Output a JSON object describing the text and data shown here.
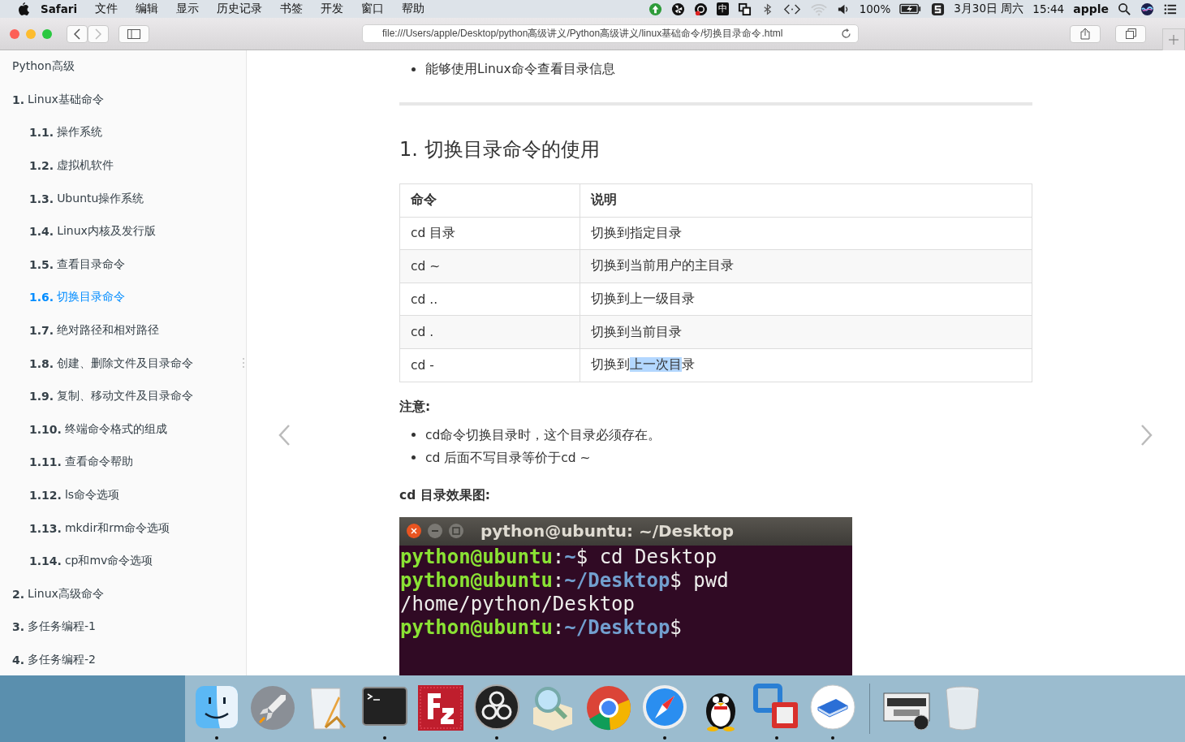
{
  "menu_bar": {
    "app": "Safari",
    "menus": [
      "文件",
      "编辑",
      "显示",
      "历史记录",
      "书签",
      "开发",
      "窗口",
      "帮助"
    ],
    "status": [
      {
        "kind": "update"
      },
      {
        "kind": "fan"
      },
      {
        "kind": "recorder"
      },
      {
        "kind": "input",
        "text": "中"
      },
      {
        "kind": "windows"
      },
      {
        "kind": "bluetooth"
      },
      {
        "kind": "code"
      },
      {
        "kind": "wifi"
      },
      {
        "kind": "volume"
      },
      {
        "kind": "text",
        "text": "100%"
      },
      {
        "kind": "battery"
      },
      {
        "kind": "sogou"
      },
      {
        "kind": "text",
        "text": "3月30日 周六"
      },
      {
        "kind": "text",
        "text": "15:44"
      },
      {
        "kind": "bold",
        "text": "apple"
      },
      {
        "kind": "search"
      },
      {
        "kind": "siri"
      },
      {
        "kind": "list"
      }
    ]
  },
  "toolbar": {
    "address": "file:///Users/apple/Desktop/python高级讲义/Python高级讲义/linux基础命令/切换目录命令.html"
  },
  "sidebar": {
    "title": "Python高级",
    "chapters": [
      {
        "number": "1.",
        "label": "Linux基础命令",
        "selected": false,
        "children": [
          {
            "number": "1.1.",
            "label": "操作系统",
            "selected": false
          },
          {
            "number": "1.2.",
            "label": "虚拟机软件",
            "selected": false
          },
          {
            "number": "1.3.",
            "label": "Ubuntu操作系统",
            "selected": false
          },
          {
            "number": "1.4.",
            "label": "Linux内核及发行版",
            "selected": false
          },
          {
            "number": "1.5.",
            "label": "查看目录命令",
            "selected": false
          },
          {
            "number": "1.6.",
            "label": "切换目录命令",
            "selected": true
          },
          {
            "number": "1.7.",
            "label": "绝对路径和相对路径",
            "selected": false
          },
          {
            "number": "1.8.",
            "label": "创建、删除文件及目录命令",
            "selected": false
          },
          {
            "number": "1.9.",
            "label": "复制、移动文件及目录命令",
            "selected": false
          },
          {
            "number": "1.10.",
            "label": "终端命令格式的组成",
            "selected": false
          },
          {
            "number": "1.11.",
            "label": "查看命令帮助",
            "selected": false
          },
          {
            "number": "1.12.",
            "label": "ls命令选项",
            "selected": false
          },
          {
            "number": "1.13.",
            "label": "mkdir和rm命令选项",
            "selected": false
          },
          {
            "number": "1.14.",
            "label": "cp和mv命令选项",
            "selected": false
          }
        ]
      },
      {
        "number": "2.",
        "label": "Linux高级命令",
        "selected": false
      },
      {
        "number": "3.",
        "label": "多任务编程-1",
        "selected": false
      },
      {
        "number": "4.",
        "label": "多任务编程-2",
        "selected": false
      }
    ]
  },
  "article": {
    "intro_bullets": [
      "能够使用Linux命令查看目录信息"
    ],
    "heading": "1. 切换目录命令的使用",
    "table": {
      "columns": [
        "命令",
        "说明"
      ],
      "rows": [
        [
          [
            {
              "text": "cd 目录",
              "selected": false
            }
          ],
          [
            {
              "text": "切换到指定目录",
              "selected": false
            }
          ]
        ],
        [
          [
            {
              "text": "cd ~",
              "selected": false
            }
          ],
          [
            {
              "text": "切换到当前用户的主目录",
              "selected": false
            }
          ]
        ],
        [
          [
            {
              "text": "cd ..",
              "selected": false
            }
          ],
          [
            {
              "text": "切换到上一级目录",
              "selected": false
            }
          ]
        ],
        [
          [
            {
              "text": "cd .",
              "selected": false
            }
          ],
          [
            {
              "text": "切换到当前目录",
              "selected": false
            }
          ]
        ],
        [
          [
            {
              "text": "cd -",
              "selected": false
            }
          ],
          [
            {
              "text": "切换到",
              "selected": false
            },
            {
              "text": "上一次目",
              "selected": true
            },
            {
              "text": "录",
              "selected": false
            }
          ]
        ]
      ]
    },
    "note_title": "注意:",
    "notes": [
      "cd命令切换目录时，这个目录必须存在。",
      "cd 后面不写目录等价于cd ~"
    ],
    "figure_title": "cd 目录效果图:",
    "terminal": {
      "title": "python@ubuntu: ~/Desktop",
      "lines": [
        [
          {
            "kind": "user",
            "text": "python@ubuntu"
          },
          {
            "kind": "text",
            "text": ":"
          },
          {
            "kind": "path",
            "text": "~"
          },
          {
            "kind": "text",
            "text": "$ cd Desktop"
          }
        ],
        [
          {
            "kind": "user",
            "text": "python@ubuntu"
          },
          {
            "kind": "text",
            "text": ":"
          },
          {
            "kind": "path",
            "text": "~/Desktop"
          },
          {
            "kind": "text",
            "text": "$ pwd"
          }
        ],
        [
          {
            "kind": "text",
            "text": "/home/python/Desktop"
          }
        ],
        [
          {
            "kind": "user",
            "text": "python@ubuntu"
          },
          {
            "kind": "text",
            "text": ":"
          },
          {
            "kind": "path",
            "text": "~/Desktop"
          },
          {
            "kind": "text",
            "text": "$"
          }
        ]
      ]
    }
  },
  "dock": [
    {
      "kind": "finder",
      "running": true
    },
    {
      "kind": "rocket",
      "running": false
    },
    {
      "kind": "pencil",
      "running": false
    },
    {
      "kind": "terminal",
      "running": true
    },
    {
      "kind": "ftp",
      "running": false
    },
    {
      "kind": "obs",
      "running": true
    },
    {
      "kind": "magnifier",
      "running": false
    },
    {
      "kind": "chrome",
      "running": false
    },
    {
      "kind": "compass",
      "running": true
    },
    {
      "kind": "penguin",
      "running": false
    },
    {
      "kind": "squares",
      "running": true
    },
    {
      "kind": "book",
      "running": true
    },
    {
      "kind": "separator"
    },
    {
      "kind": "thumbnail",
      "running": false
    },
    {
      "kind": "trash",
      "running": false
    }
  ]
}
